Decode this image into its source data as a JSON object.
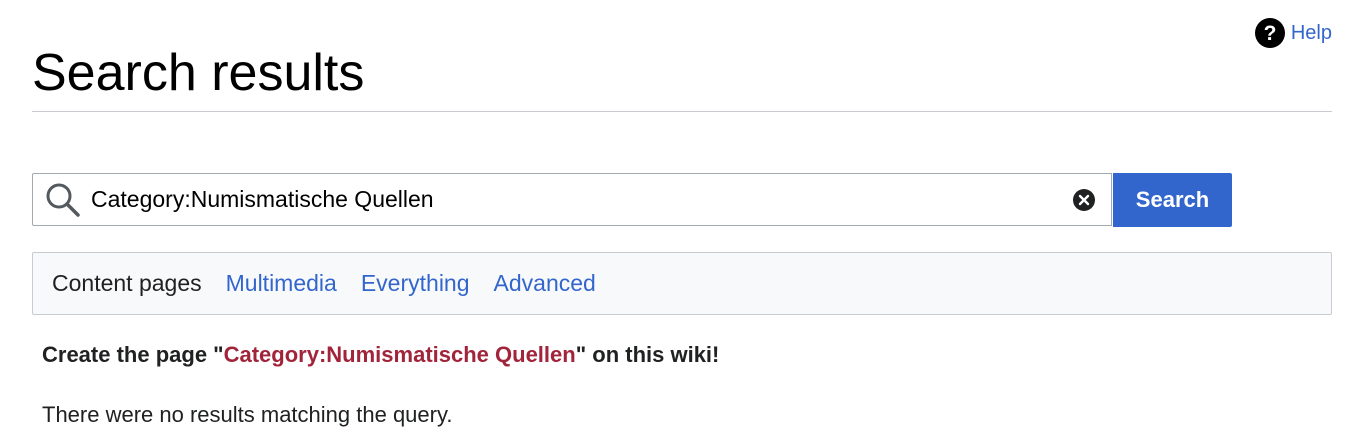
{
  "header": {
    "title": "Search results",
    "help_label": "Help"
  },
  "search": {
    "value": "Category:Numismatische Quellen",
    "button_label": "Search"
  },
  "tabs": [
    {
      "label": "Content pages",
      "active": true
    },
    {
      "label": "Multimedia",
      "active": false
    },
    {
      "label": "Everything",
      "active": false
    },
    {
      "label": "Advanced",
      "active": false
    }
  ],
  "create": {
    "prefix": "Create the page \"",
    "link_text": "Category:Numismatische Quellen",
    "suffix": "\" on this wiki!"
  },
  "no_results": "There were no results matching the query.",
  "colors": {
    "link": "#3366cc",
    "redlink": "#a2243a",
    "button": "#3366cc"
  },
  "icons": {
    "help": "question-circle-icon",
    "search": "search-icon",
    "clear": "clear-icon"
  }
}
